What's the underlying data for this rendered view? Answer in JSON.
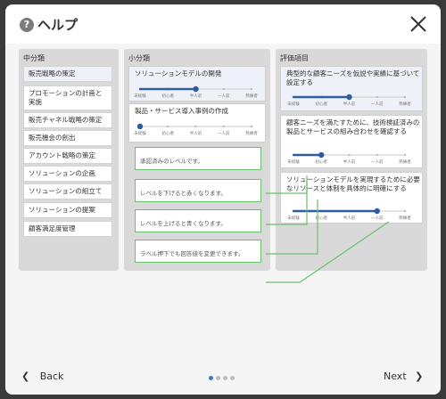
{
  "header": {
    "title": "ヘルプ",
    "help_glyph": "?"
  },
  "columns": {
    "mid": {
      "heading": "中分類",
      "items": [
        "販売戦略の策定",
        "プロモーションの計画と実施",
        "販売チャネル戦略の策定",
        "販売機会の創出",
        "アカウント戦略の策定",
        "ソリューションの企画",
        "ソリューションの組立て",
        "ソリューションの提案",
        "顧客満足度管理"
      ]
    },
    "sub": {
      "heading": "小分類",
      "cards": [
        "ソリューションモデルの開発",
        "製品・サービス導入事例の作成"
      ]
    },
    "eval": {
      "heading": "評価項目",
      "cards": [
        "典型的な顧客ニーズを仮説や実績に基づいて設定する",
        "顧客ニーズを満たすために、技術検証済みの製品とサービスの組み合わせを確認する",
        "ソリューションモデルを実現するために必要なリソースと体制を具体的に明確にする"
      ]
    }
  },
  "scale_labels": [
    "未経験",
    "初心者",
    "半人前",
    "一人前",
    "熟練者"
  ],
  "levels": {
    "sub_card_1": 3,
    "sub_card_2": 1,
    "eval_card_1": 3,
    "eval_card_2": 2,
    "eval_card_3": 4
  },
  "notes": [
    "承認済みのレベルです。",
    "レベルを下げると赤くなります。",
    "レベルを上げると青くなります。",
    "ラベル押下でも回答値を変更できます。"
  ],
  "footer": {
    "back": "Back",
    "next": "Next",
    "page_count": 4,
    "current_page": 1
  },
  "colors": {
    "accent": "#2e5d9e",
    "approved": "#6cbf6c",
    "down": "#e05a5a",
    "up": "#3c78c8"
  }
}
